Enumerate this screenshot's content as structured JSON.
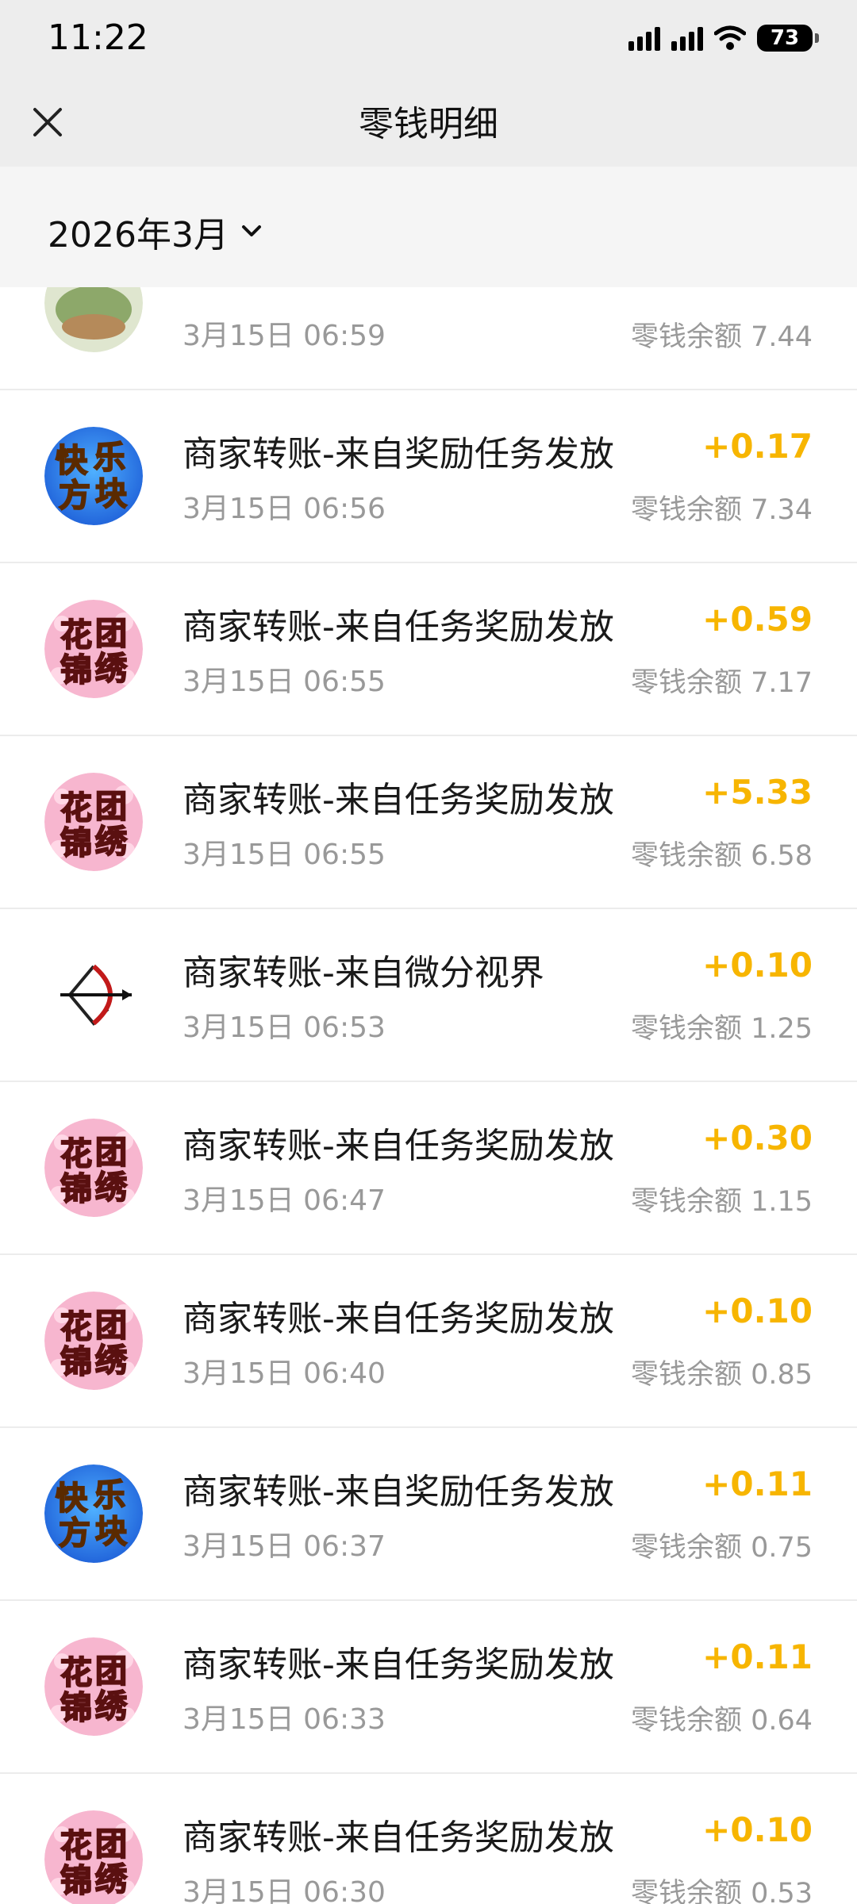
{
  "status": {
    "time": "11:22",
    "battery": "73"
  },
  "header": {
    "title": "零钱明细"
  },
  "filter": {
    "month": "2026年3月"
  },
  "transactions": [
    {
      "avatar": "bush-avatar",
      "title": "",
      "time": "3月15日 06:59",
      "amount": "",
      "balance": "零钱余额 7.44"
    },
    {
      "avatar": "kuaile-fangkuai-logo",
      "logo_text": [
        "快",
        "乐",
        "方",
        "块"
      ],
      "title": "商家转账-来自奖励任务发放",
      "time": "3月15日 06:56",
      "amount": "+0.17",
      "balance": "零钱余额 7.34"
    },
    {
      "avatar": "huatuan-jinxiu-logo",
      "logo_text": [
        "花",
        "团",
        "锦",
        "绣"
      ],
      "title": "商家转账-来自任务奖励发放",
      "time": "3月15日 06:55",
      "amount": "+0.59",
      "balance": "零钱余额 7.17"
    },
    {
      "avatar": "huatuan-jinxiu-logo",
      "logo_text": [
        "花",
        "团",
        "锦",
        "绣"
      ],
      "title": "商家转账-来自任务奖励发放",
      "time": "3月15日 06:55",
      "amount": "+5.33",
      "balance": "零钱余额 6.58"
    },
    {
      "avatar": "bow-arrow-icon",
      "title": "商家转账-来自微分视界",
      "time": "3月15日 06:53",
      "amount": "+0.10",
      "balance": "零钱余额 1.25"
    },
    {
      "avatar": "huatuan-jinxiu-logo",
      "logo_text": [
        "花",
        "团",
        "锦",
        "绣"
      ],
      "title": "商家转账-来自任务奖励发放",
      "time": "3月15日 06:47",
      "amount": "+0.30",
      "balance": "零钱余额 1.15"
    },
    {
      "avatar": "huatuan-jinxiu-logo",
      "logo_text": [
        "花",
        "团",
        "锦",
        "绣"
      ],
      "title": "商家转账-来自任务奖励发放",
      "time": "3月15日 06:40",
      "amount": "+0.10",
      "balance": "零钱余额 0.85"
    },
    {
      "avatar": "kuaile-fangkuai-logo",
      "logo_text": [
        "快",
        "乐",
        "方",
        "块"
      ],
      "title": "商家转账-来自奖励任务发放",
      "time": "3月15日 06:37",
      "amount": "+0.11",
      "balance": "零钱余额 0.75"
    },
    {
      "avatar": "huatuan-jinxiu-logo",
      "logo_text": [
        "花",
        "团",
        "锦",
        "绣"
      ],
      "title": "商家转账-来自任务奖励发放",
      "time": "3月15日 06:33",
      "amount": "+0.11",
      "balance": "零钱余额 0.64"
    },
    {
      "avatar": "huatuan-jinxiu-logo",
      "logo_text": [
        "花",
        "团",
        "锦",
        "绣"
      ],
      "title": "商家转账-来自任务奖励发放",
      "time": "3月15日 06:30",
      "amount": "+0.10",
      "balance": "零钱余额 0.53"
    }
  ],
  "colors": {
    "amount": "#f7b500",
    "header_bg": "#ededed",
    "filter_bg": "#f5f5f5",
    "secondary_text": "#999999"
  }
}
